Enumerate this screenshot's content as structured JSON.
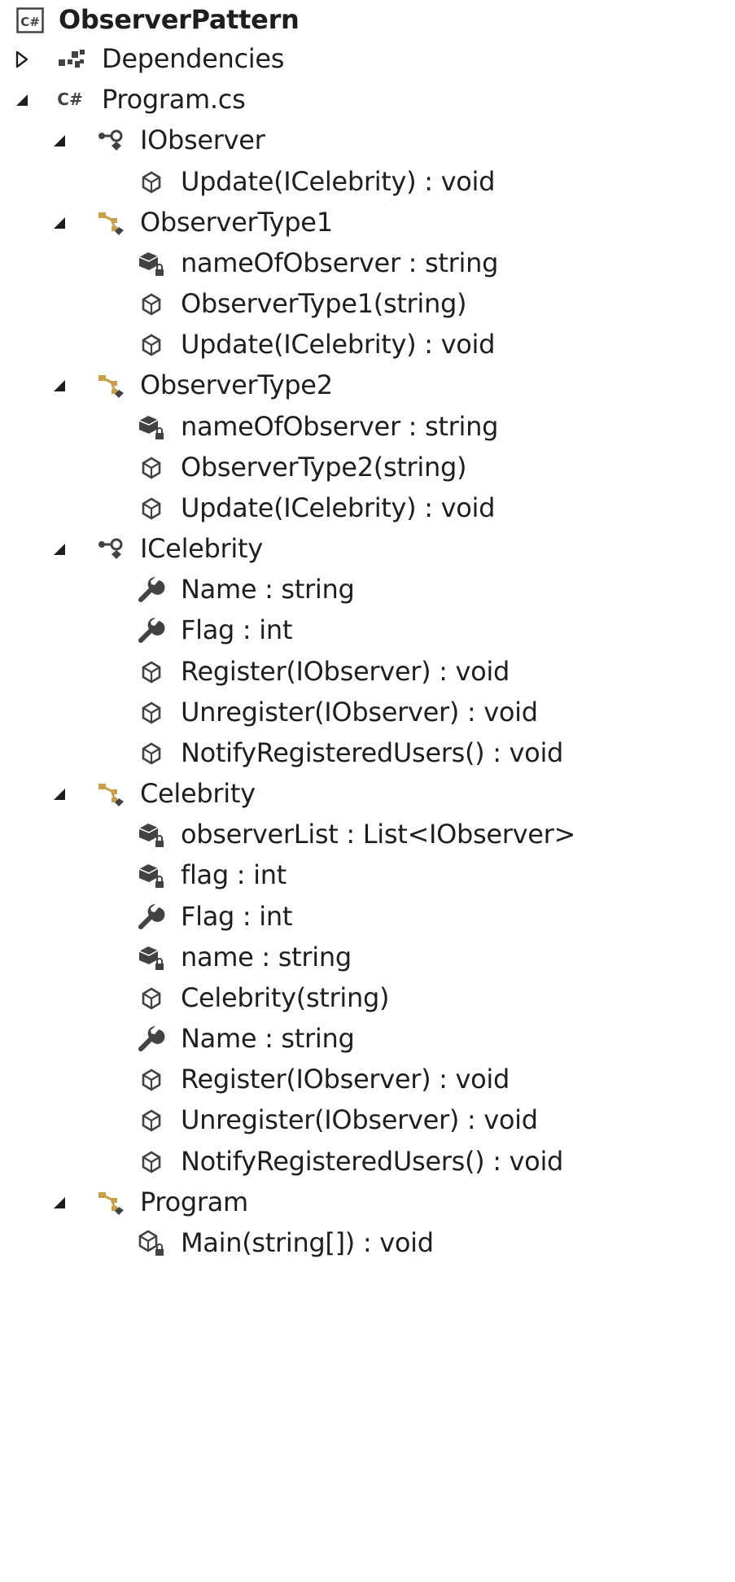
{
  "solution_tree": {
    "colors": {
      "text": "#1e1e1e",
      "arrow": "#1e1e1e",
      "class_icon": "#c8a04a",
      "interface_icon": "#424242",
      "member_icon": "#424242",
      "lock_badge": "#424242"
    },
    "rows": [
      {
        "level": 0,
        "expander": "none",
        "icon": "csharp-project-icon",
        "label": "ObserverPattern",
        "bold": true
      },
      {
        "level": 0,
        "expander": "collapsed",
        "icon": "dependencies-icon",
        "label": "Dependencies"
      },
      {
        "level": 0,
        "expander": "expanded",
        "icon": "csharp-file-icon",
        "label": "Program.cs"
      },
      {
        "level": 1,
        "expander": "expanded",
        "icon": "interface-icon",
        "label": "IObserver"
      },
      {
        "level": 2,
        "expander": "none",
        "icon": "method-icon",
        "label": "Update(ICelebrity) : void"
      },
      {
        "level": 1,
        "expander": "expanded",
        "icon": "class-icon",
        "label": "ObserverType1"
      },
      {
        "level": 2,
        "expander": "none",
        "icon": "private-field-icon",
        "label": "nameOfObserver : string"
      },
      {
        "level": 2,
        "expander": "none",
        "icon": "method-icon",
        "label": "ObserverType1(string)"
      },
      {
        "level": 2,
        "expander": "none",
        "icon": "method-icon",
        "label": "Update(ICelebrity) : void"
      },
      {
        "level": 1,
        "expander": "expanded",
        "icon": "class-icon",
        "label": "ObserverType2"
      },
      {
        "level": 2,
        "expander": "none",
        "icon": "private-field-icon",
        "label": "nameOfObserver : string"
      },
      {
        "level": 2,
        "expander": "none",
        "icon": "method-icon",
        "label": "ObserverType2(string)"
      },
      {
        "level": 2,
        "expander": "none",
        "icon": "method-icon",
        "label": "Update(ICelebrity) : void"
      },
      {
        "level": 1,
        "expander": "expanded",
        "icon": "interface-icon",
        "label": "ICelebrity"
      },
      {
        "level": 2,
        "expander": "none",
        "icon": "property-icon",
        "label": "Name : string"
      },
      {
        "level": 2,
        "expander": "none",
        "icon": "property-icon",
        "label": "Flag : int"
      },
      {
        "level": 2,
        "expander": "none",
        "icon": "method-icon",
        "label": "Register(IObserver) : void"
      },
      {
        "level": 2,
        "expander": "none",
        "icon": "method-icon",
        "label": "Unregister(IObserver) : void"
      },
      {
        "level": 2,
        "expander": "none",
        "icon": "method-icon",
        "label": "NotifyRegisteredUsers() : void"
      },
      {
        "level": 1,
        "expander": "expanded",
        "icon": "class-icon",
        "label": "Celebrity"
      },
      {
        "level": 2,
        "expander": "none",
        "icon": "private-field-icon",
        "label": "observerList : List<IObserver>"
      },
      {
        "level": 2,
        "expander": "none",
        "icon": "private-field-icon",
        "label": "flag : int"
      },
      {
        "level": 2,
        "expander": "none",
        "icon": "property-icon",
        "label": "Flag : int"
      },
      {
        "level": 2,
        "expander": "none",
        "icon": "private-field-icon",
        "label": "name : string"
      },
      {
        "level": 2,
        "expander": "none",
        "icon": "method-icon",
        "label": "Celebrity(string)"
      },
      {
        "level": 2,
        "expander": "none",
        "icon": "property-icon",
        "label": "Name : string"
      },
      {
        "level": 2,
        "expander": "none",
        "icon": "method-icon",
        "label": "Register(IObserver) : void"
      },
      {
        "level": 2,
        "expander": "none",
        "icon": "method-icon",
        "label": "Unregister(IObserver) : void"
      },
      {
        "level": 2,
        "expander": "none",
        "icon": "method-icon",
        "label": "NotifyRegisteredUsers() : void"
      },
      {
        "level": 1,
        "expander": "expanded",
        "icon": "class-icon",
        "label": "Program"
      },
      {
        "level": 2,
        "expander": "none",
        "icon": "private-method-icon",
        "label": "Main(string[]) : void"
      }
    ]
  }
}
